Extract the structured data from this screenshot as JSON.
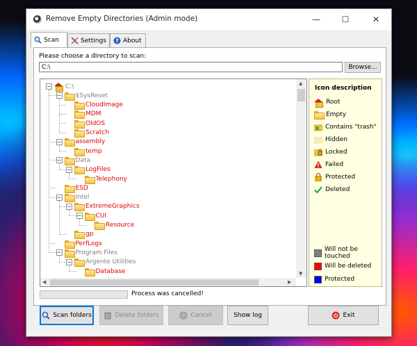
{
  "window": {
    "title": "Remove Empty Directories (Admin mode)",
    "minimize": "—",
    "maximize": "☐",
    "close": "✕"
  },
  "tabs": [
    {
      "label": "Scan",
      "icon": "magnifier-icon",
      "active": true
    },
    {
      "label": "Settings",
      "icon": "tools-icon",
      "active": false
    },
    {
      "label": "About",
      "icon": "help-icon",
      "active": false
    }
  ],
  "scan": {
    "choose_label": "Please choose a directory to scan:",
    "path_value": "C:\\",
    "browse_label": "Browse..."
  },
  "tree": [
    {
      "label": "C:\\",
      "color": "gray",
      "icon": "root"
    },
    {
      "label": "$SysReset",
      "color": "gray",
      "icon": "folder"
    },
    {
      "label": "CloudImage",
      "color": "red",
      "icon": "folder"
    },
    {
      "label": "MDM",
      "color": "red",
      "icon": "folder"
    },
    {
      "label": "OldOS",
      "color": "red",
      "icon": "folder"
    },
    {
      "label": "Scratch",
      "color": "red",
      "icon": "folder"
    },
    {
      "label": "assembly",
      "color": "red",
      "icon": "folder"
    },
    {
      "label": "temp",
      "color": "red",
      "icon": "folder"
    },
    {
      "label": "Data",
      "color": "gray",
      "icon": "folder"
    },
    {
      "label": "LogFiles",
      "color": "red",
      "icon": "folder"
    },
    {
      "label": "Telephony",
      "color": "red",
      "icon": "folder"
    },
    {
      "label": "ESD",
      "color": "red",
      "icon": "folder"
    },
    {
      "label": "Intel",
      "color": "gray",
      "icon": "folder"
    },
    {
      "label": "ExtremeGraphics",
      "color": "red",
      "icon": "folder"
    },
    {
      "label": "CUI",
      "color": "red",
      "icon": "folder"
    },
    {
      "label": "Resource",
      "color": "red",
      "icon": "folder"
    },
    {
      "label": "gp",
      "color": "red",
      "icon": "folder"
    },
    {
      "label": "PerfLogs",
      "color": "red",
      "icon": "folder"
    },
    {
      "label": "Program Files",
      "color": "gray",
      "icon": "folder"
    },
    {
      "label": "Argente Utilities",
      "color": "gray",
      "icon": "folder"
    },
    {
      "label": "Database",
      "color": "red",
      "icon": "folder"
    }
  ],
  "legend": {
    "title": "Icon description",
    "items": [
      {
        "label": "Root",
        "icon": "root-icon"
      },
      {
        "label": "Empty",
        "icon": "empty-folder-icon"
      },
      {
        "label": "Contains \"trash\"",
        "icon": "trash-folder-icon"
      },
      {
        "label": "Hidden",
        "icon": "hidden-folder-icon"
      },
      {
        "label": "Locked",
        "icon": "locked-folder-icon"
      },
      {
        "label": "Failed",
        "icon": "warning-icon"
      },
      {
        "label": "Protected",
        "icon": "lock-icon"
      },
      {
        "label": "Deleted",
        "icon": "checkmark-icon"
      }
    ],
    "colors": [
      {
        "label": "Will not be touched",
        "color": "#808080"
      },
      {
        "label": "Will be deleted",
        "color": "#ff0000"
      },
      {
        "label": "Protected",
        "color": "#0000ff"
      }
    ]
  },
  "progress": {
    "fraction": 0.0
  },
  "status_text": "Process was cancelled!",
  "buttons": {
    "scan": "Scan folders",
    "delete": "Delete folders",
    "cancel": "Cancel",
    "show_log": "Show log",
    "exit": "Exit"
  }
}
